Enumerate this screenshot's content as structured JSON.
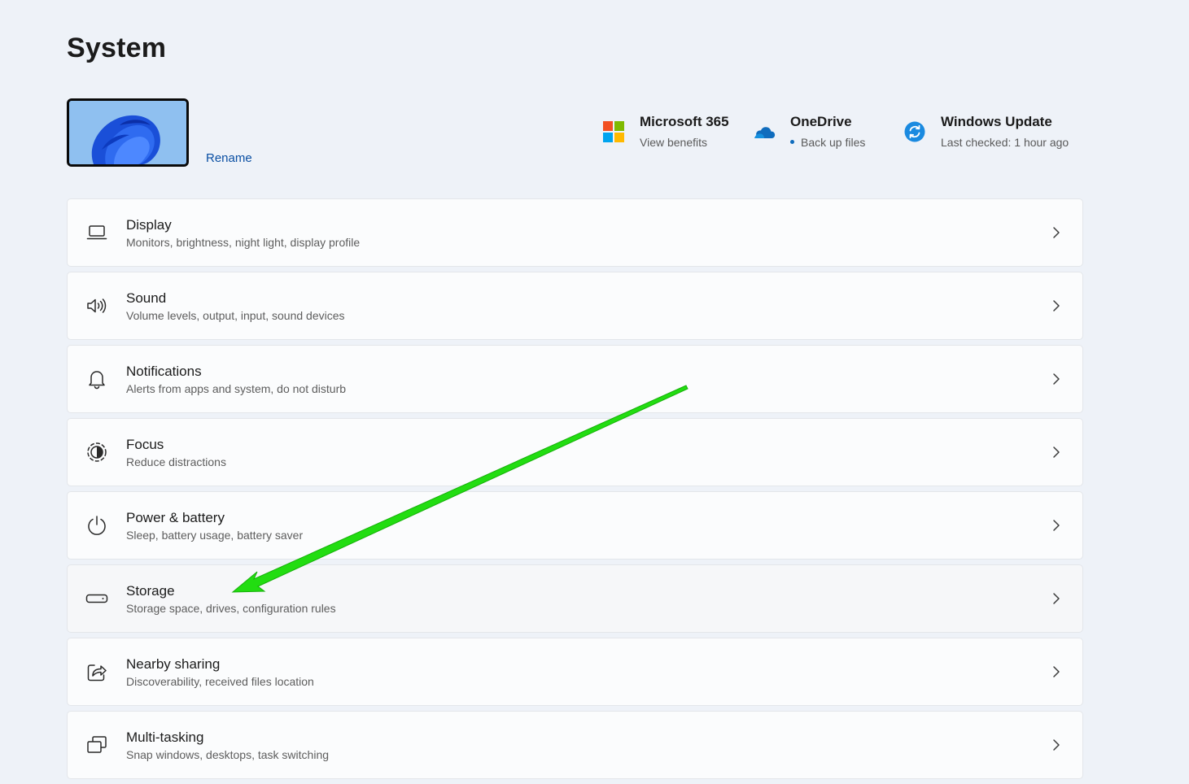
{
  "page": {
    "title": "System"
  },
  "device": {
    "rename_label": "Rename"
  },
  "top_items": [
    {
      "title": "Microsoft 365",
      "subtitle": "View benefits",
      "icon": "microsoft-logo-icon"
    },
    {
      "title": "OneDrive",
      "subtitle": "Back up files",
      "icon": "onedrive-cloud-icon"
    },
    {
      "title": "Windows Update",
      "subtitle": "Last checked: 1 hour ago",
      "icon": "windows-update-icon"
    }
  ],
  "settings": [
    {
      "title": "Display",
      "subtitle": "Monitors, brightness, night light, display profile",
      "icon": "laptop-icon"
    },
    {
      "title": "Sound",
      "subtitle": "Volume levels, output, input, sound devices",
      "icon": "speaker-icon"
    },
    {
      "title": "Notifications",
      "subtitle": "Alerts from apps and system, do not disturb",
      "icon": "bell-icon"
    },
    {
      "title": "Focus",
      "subtitle": "Reduce distractions",
      "icon": "focus-icon"
    },
    {
      "title": "Power & battery",
      "subtitle": "Sleep, battery usage, battery saver",
      "icon": "power-icon"
    },
    {
      "title": "Storage",
      "subtitle": "Storage space, drives, configuration rules",
      "icon": "storage-drive-icon"
    },
    {
      "title": "Nearby sharing",
      "subtitle": "Discoverability, received files location",
      "icon": "share-icon"
    },
    {
      "title": "Multi-tasking",
      "subtitle": "Snap windows, desktops, task switching",
      "icon": "multitasking-icon"
    }
  ],
  "colors": {
    "accent": "#0f6cbd",
    "annotation_arrow": "#22dd11",
    "background": "#eef2f8"
  }
}
